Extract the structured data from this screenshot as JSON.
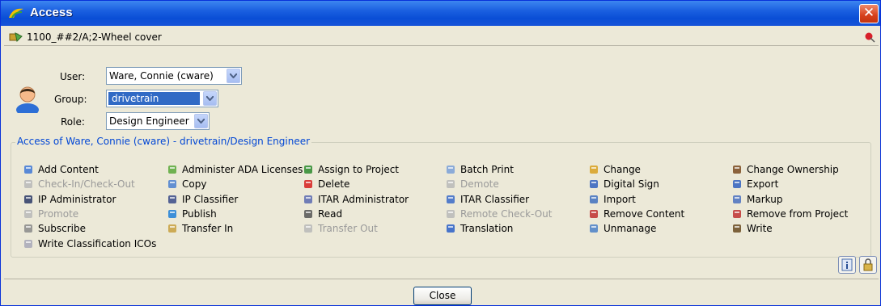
{
  "window": {
    "title": "Access",
    "close_glyph": "✕"
  },
  "object": {
    "label": "1100_##2/A;2-Wheel cover",
    "icon": "part-icon",
    "pin_icon": "pin-icon"
  },
  "form": {
    "user_label": "User:",
    "user_value": "Ware, Connie (cware)",
    "group_label": "Group:",
    "group_value": "drivetrain",
    "role_label": "Role:",
    "role_value": "Design Engineer"
  },
  "access": {
    "legend": "Access of Ware, Connie (cware) - drivetrain/Design Engineer",
    "columns": [
      [
        {
          "label": "Add Content",
          "enabled": true,
          "icon": "add-content-icon"
        },
        {
          "label": "Check-In/Check-Out",
          "enabled": false,
          "icon": "checkin-icon"
        },
        {
          "label": "IP Administrator",
          "enabled": true,
          "icon": "ip-admin-icon"
        },
        {
          "label": "Promote",
          "enabled": false,
          "icon": "promote-icon"
        },
        {
          "label": "Subscribe",
          "enabled": true,
          "icon": "subscribe-icon"
        },
        {
          "label": "Write Classification ICOs",
          "enabled": true,
          "icon": "classification-icon"
        }
      ],
      [
        {
          "label": "Administer ADA Licenses",
          "enabled": true,
          "icon": "key-icon"
        },
        {
          "label": "Copy",
          "enabled": true,
          "icon": "copy-icon"
        },
        {
          "label": "IP Classifier",
          "enabled": true,
          "icon": "ip-classifier-icon"
        },
        {
          "label": "Publish",
          "enabled": true,
          "icon": "publish-icon"
        },
        {
          "label": "Transfer In",
          "enabled": true,
          "icon": "transfer-in-icon"
        }
      ],
      [
        {
          "label": "Assign to Project",
          "enabled": true,
          "icon": "flag-icon"
        },
        {
          "label": "Delete",
          "enabled": true,
          "icon": "delete-icon"
        },
        {
          "label": "ITAR Administrator",
          "enabled": true,
          "icon": "itar-admin-icon"
        },
        {
          "label": "Read",
          "enabled": true,
          "icon": "glasses-icon"
        },
        {
          "label": "Transfer Out",
          "enabled": false,
          "icon": "transfer-out-icon"
        }
      ],
      [
        {
          "label": "Batch Print",
          "enabled": true,
          "icon": "printer-icon"
        },
        {
          "label": "Demote",
          "enabled": false,
          "icon": "demote-icon"
        },
        {
          "label": "ITAR Classifier",
          "enabled": true,
          "icon": "itar-classifier-icon"
        },
        {
          "label": "Remote Check-Out",
          "enabled": false,
          "icon": "remote-checkout-icon"
        },
        {
          "label": "Translation",
          "enabled": true,
          "icon": "translation-icon"
        }
      ],
      [
        {
          "label": "Change",
          "enabled": true,
          "icon": "change-key-icon"
        },
        {
          "label": "Digital Sign",
          "enabled": true,
          "icon": "digital-sign-icon"
        },
        {
          "label": "Import",
          "enabled": true,
          "icon": "import-icon"
        },
        {
          "label": "Remove Content",
          "enabled": true,
          "icon": "remove-content-icon"
        },
        {
          "label": "Unmanage",
          "enabled": true,
          "icon": "unmanage-icon"
        }
      ],
      [
        {
          "label": "Change Ownership",
          "enabled": true,
          "icon": "ownership-icon"
        },
        {
          "label": "Export",
          "enabled": true,
          "icon": "export-icon"
        },
        {
          "label": "Markup",
          "enabled": true,
          "icon": "markup-icon"
        },
        {
          "label": "Remove from Project",
          "enabled": true,
          "icon": "remove-project-icon"
        },
        {
          "label": "Write",
          "enabled": true,
          "icon": "pencil-icon"
        }
      ]
    ]
  },
  "footer": {
    "close_label": "Close"
  }
}
